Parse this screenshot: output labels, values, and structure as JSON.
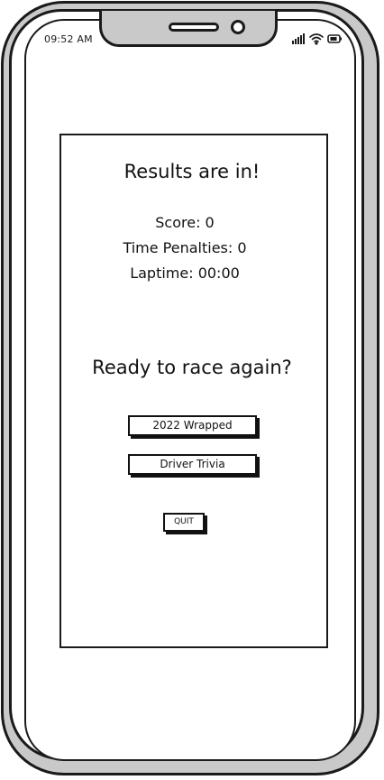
{
  "status_bar": {
    "time": "09:52 AM",
    "icons": [
      "signal-icon",
      "wifi-icon",
      "battery-icon"
    ]
  },
  "results": {
    "title": "Results are in!",
    "score": "Score: 0",
    "time_penalties": "Time Penalties: 0",
    "laptime": "Laptime: 00:00"
  },
  "replay": {
    "heading": "Ready to race again?",
    "wrapped_label": "2022 Wrapped",
    "trivia_label": "Driver Trivia",
    "quit_label": "QUIT"
  }
}
